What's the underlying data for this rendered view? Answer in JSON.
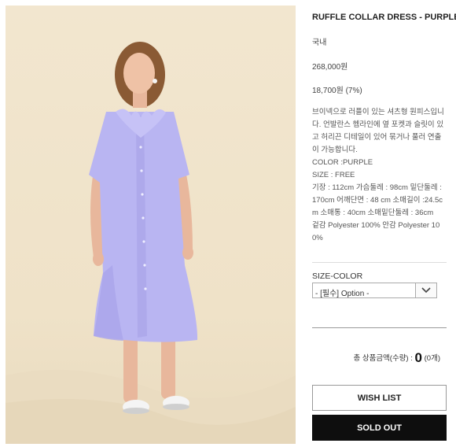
{
  "product": {
    "title": "RUFFLE COLLAR DRESS - PURPLE",
    "origin": "국내",
    "price": "268,000원",
    "discount": "18,700원 (7%)",
    "description": [
      "브이넥으로 러플이 있는 셔츠형 원피스입니다. 언발란스 헴라인에 옆 포켓과 슬릿이 있고 허리끈 디테일이 있어 묶거나 풀러 연출이 가능합니다.",
      "COLOR :PURPLE",
      "SIZE : FREE",
      "기장 : 112cm 가슴둘레 : 98cm 밑단둘레 : 170cm 어깨단면 : 48 cm 소매길이 :24.5cm 소매통 : 40cm 소매밑단둘레 : 36cm",
      "겉감 Polyester 100% 안감 Polyester 100%"
    ]
  },
  "options": {
    "label": "SIZE-COLOR",
    "selected": "- [필수] Option -"
  },
  "total": {
    "label": "총 상품금액(수량) : ",
    "amount": "0",
    "qty": "(0개)"
  },
  "buttons": {
    "wish": "WISH LIST",
    "sold": "SOLD OUT"
  },
  "colors": {
    "dress": "#b8b4f0",
    "background": "#f0e4cb",
    "soldout_bg": "#0e0e0e"
  },
  "icons": {
    "select_arrow": "chevron-down-icon"
  }
}
